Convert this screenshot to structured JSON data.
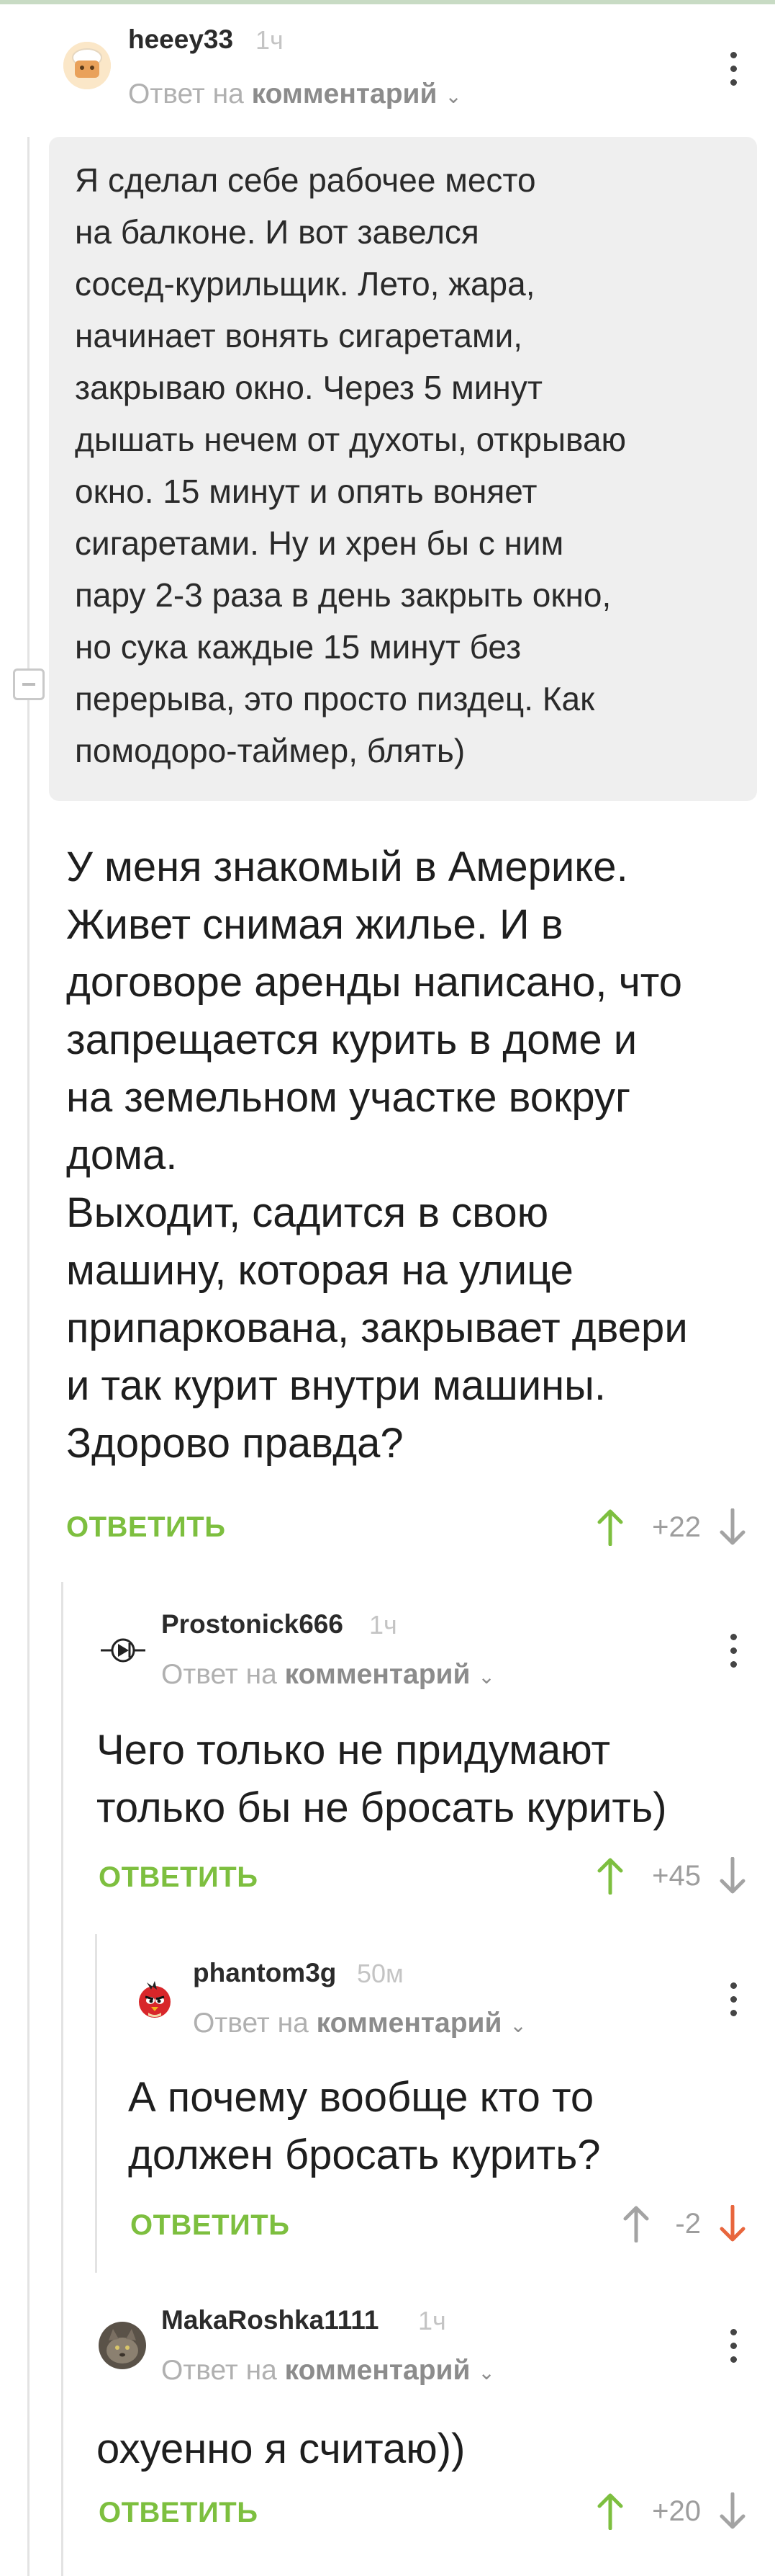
{
  "comments": [
    {
      "username": "heeey33",
      "time": "1ч",
      "reply_prefix": "Ответ на",
      "reply_target": "комментарий",
      "quote": "Я сделал себе рабочее место\nна балконе. И вот завелся\nсосед-курильщик. Лето, жара,\nначинает вонять сигаретами,\nзакрываю окно. Через 5 минут\nдышать нечем от духоты, открываю\nокно. 15 минут и опять воняет\nсигаретами. Ну и хрен бы с ним\nпару 2-3 раза в день закрыть окно,\nно сука каждые 15 минут без\nперерыва, это просто пиздец. Как\nпомодоро-таймер, блять)",
      "text": "У меня знакомый в Америке.\nЖивет снимая жилье. И в\nдоговоре аренды написано, что\nзапрещается курить в доме и\nна земельном участке вокруг\nдома.\nВыходит, садится в свою\nмашину, которая на улице\nприпаркована, закрывает двери\nи так курит внутри машины.\nЗдорово правда?",
      "reply_label": "ОТВЕТИТЬ",
      "score": "+22"
    },
    {
      "username": "Prostonick666",
      "time": "1ч",
      "reply_prefix": "Ответ на",
      "reply_target": "комментарий",
      "text": "Чего только не придумают\nтолько бы не бросать курить)",
      "reply_label": "ОТВЕТИТЬ",
      "score": "+45"
    },
    {
      "username": "phantom3g",
      "time": "50м",
      "reply_prefix": "Ответ на",
      "reply_target": "комментарий",
      "text": "А почему вообще кто то\nдолжен бросать курить?",
      "reply_label": "ОТВЕТИТЬ",
      "score": "-2"
    },
    {
      "username": "MakaRoshka1111",
      "time": "1ч",
      "reply_prefix": "Ответ на",
      "reply_target": "комментарий",
      "text": "охуенно я считаю))",
      "reply_label": "ОТВЕТИТЬ",
      "score": "+20"
    }
  ],
  "icons": {
    "vote_up": "arrow-up-icon",
    "vote_down": "arrow-down-icon",
    "menu": "more-vertical-icon",
    "collapse": "collapse-thread-icon"
  },
  "colors": {
    "accent_green": "#7dbf3f",
    "downvote_active": "#e8663d",
    "meta_gray": "#b0b0b0"
  }
}
